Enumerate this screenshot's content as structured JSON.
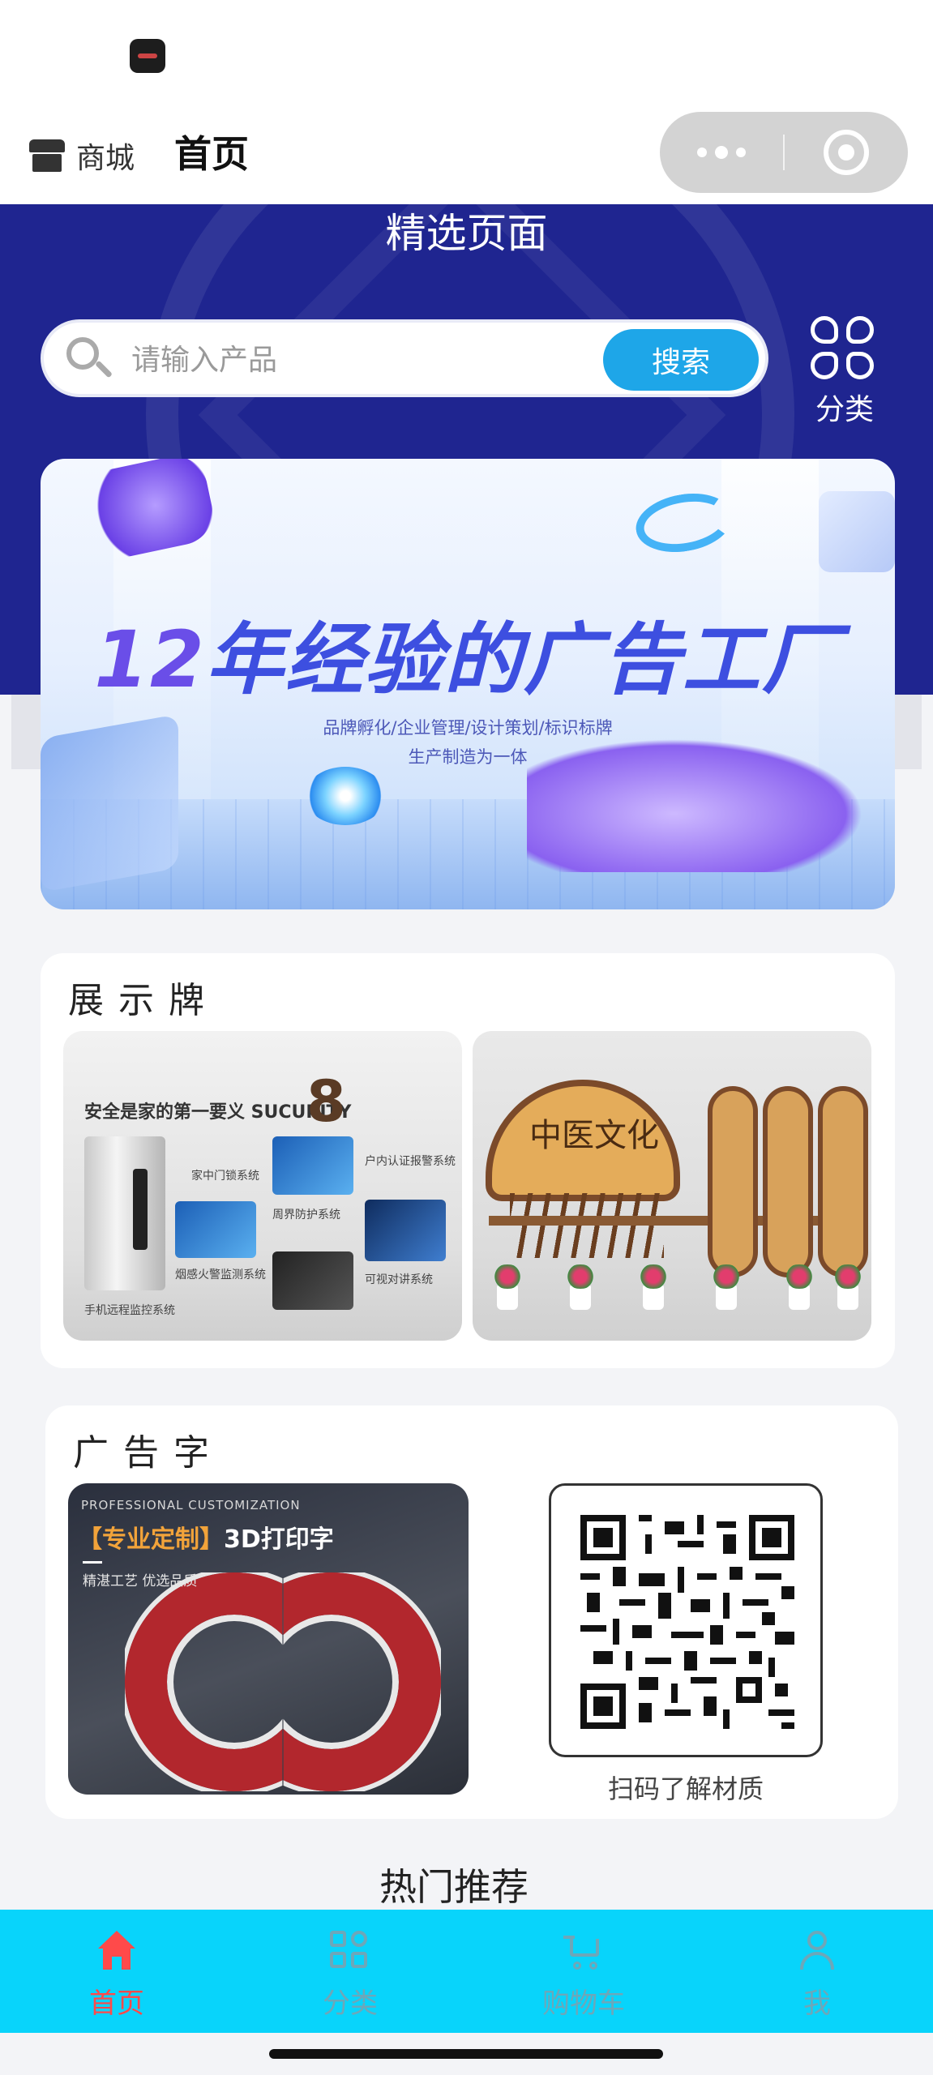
{
  "nav": {
    "shop_label": "商城",
    "page_title": "首页"
  },
  "hero": {
    "title": "精选页面",
    "search_placeholder": "请输入产品",
    "search_button": "搜索",
    "category_label": "分类"
  },
  "banner": {
    "headline_number": "12",
    "headline_text": "年经验的广告工厂",
    "subline_1": "品牌孵化/企业管理/设计策划/标识标牌",
    "subline_2": "生产制造为一体"
  },
  "sections": {
    "display_signs": {
      "title": "展示牌",
      "image_1": {
        "headline": "安全是家的第一要义 SUCURITY",
        "number": "8",
        "label_1": "家中门锁系统",
        "label_2": "户内认证报警系统",
        "label_3": "周界防护系统",
        "label_4": "可视对讲系统",
        "label_5": "烟感火警监测系统",
        "label_6": "手机远程监控系统"
      },
      "image_2": {
        "fan_text": "中医文化"
      }
    },
    "ad_letters": {
      "title": "广告字",
      "image": {
        "subtitle": "PROFESSIONAL CUSTOMIZATION",
        "title_bracket": "【专业定制】",
        "title_text": "3D打印字",
        "tagline": "精湛工艺 优选品质"
      },
      "qr_caption": "扫码了解材质"
    }
  },
  "hot_title": "热门推荐",
  "tabs": [
    {
      "label": "首页",
      "icon": "home-icon",
      "active": true
    },
    {
      "label": "分类",
      "icon": "category-icon",
      "active": false
    },
    {
      "label": "购物车",
      "icon": "cart-icon",
      "active": false
    },
    {
      "label": "我",
      "icon": "profile-icon",
      "active": false
    }
  ],
  "colors": {
    "hero_bg": "#1f2590",
    "search_button": "#1ea6e8",
    "tab_bar": "#08d4fb",
    "tab_active": "#ff4a4a",
    "tab_inactive": "#6da7b9"
  }
}
